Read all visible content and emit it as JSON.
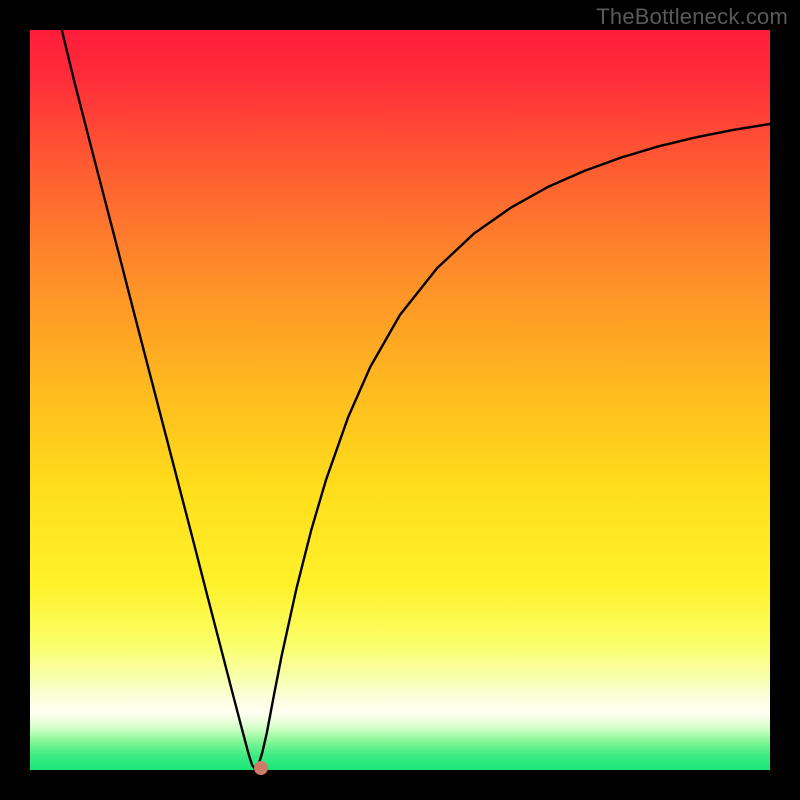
{
  "watermark": "TheBottleneck.com",
  "chart_data": {
    "type": "line",
    "title": "",
    "xlabel": "",
    "ylabel": "",
    "xlim": [
      0,
      100
    ],
    "ylim": [
      0,
      100
    ],
    "grid": false,
    "legend": false,
    "background_gradient": {
      "top": "#ff1d3a",
      "upper_mid": "#ff7a2a",
      "mid": "#ffd31a",
      "lower_mid": "#f6ff7a",
      "band_light": "#fffdd0",
      "bottom": "#19e67a"
    },
    "colors": {
      "line": "#000000",
      "marker": "#cf7a68",
      "frame": "#000000"
    },
    "series": [
      {
        "name": "curve",
        "x": [
          4.3,
          6,
          8,
          10,
          12,
          14,
          16,
          18,
          20,
          22,
          24,
          26,
          27.5,
          28.6,
          29.5,
          30,
          30.4,
          30.7,
          31,
          31.4,
          32,
          33,
          34,
          36,
          38,
          40,
          43,
          46,
          50,
          55,
          60,
          65,
          70,
          75,
          80,
          85,
          90,
          95,
          100
        ],
        "y": [
          100,
          93,
          85.2,
          77.5,
          69.8,
          62,
          54.3,
          46.6,
          38.9,
          31.2,
          23.4,
          15.7,
          9.9,
          5.7,
          2.3,
          0.7,
          0.15,
          0.4,
          1.1,
          2.4,
          5.0,
          10.3,
          15.4,
          24.5,
          32.4,
          39.2,
          47.7,
          54.5,
          61.5,
          67.8,
          72.5,
          76,
          78.8,
          81,
          82.8,
          84.3,
          85.5,
          86.5,
          87.3
        ]
      }
    ],
    "markers": [
      {
        "x": 31.2,
        "y": 0.3
      }
    ]
  }
}
